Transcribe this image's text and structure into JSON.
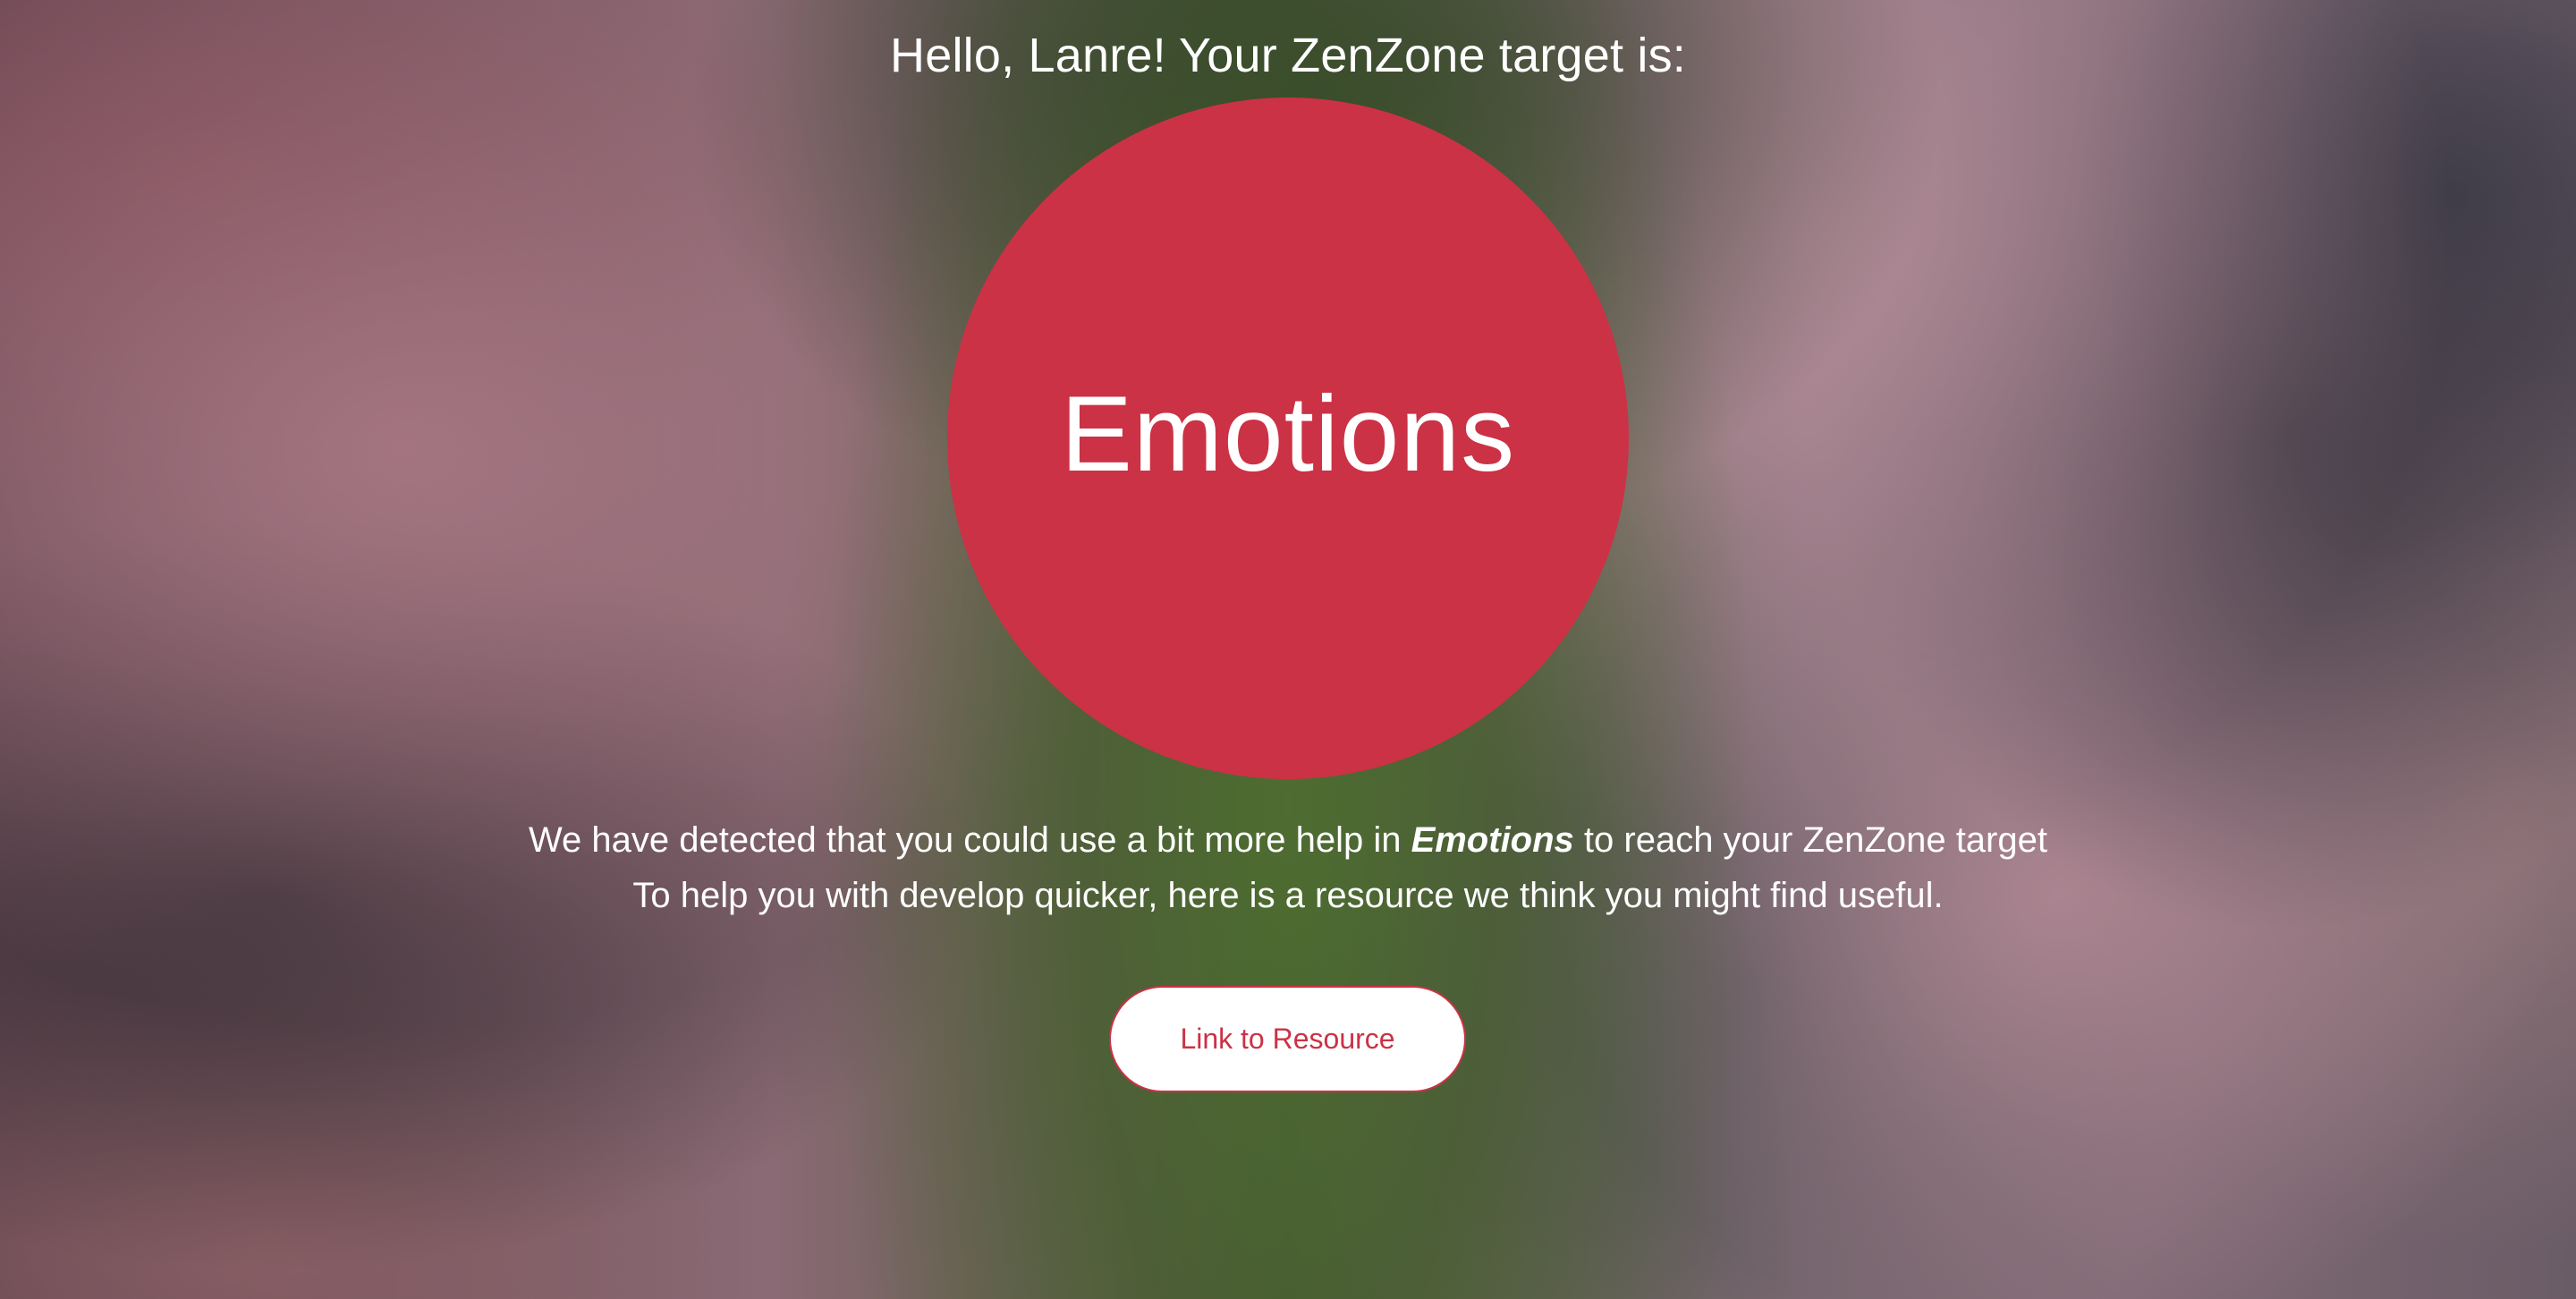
{
  "header": {
    "title": "Hello, Lanre! Your ZenZone target is:"
  },
  "target": {
    "label": "Emotions",
    "color": "#cb3245"
  },
  "message": {
    "line1_before": "We have detected that you could use a bit more help in ",
    "line1_highlight": "Emotions",
    "line1_after": " to reach your ZenZone target",
    "line2": "To help you with develop quicker, here is a resource we think you might find useful."
  },
  "resource_button": {
    "label": "Link to Resource"
  }
}
